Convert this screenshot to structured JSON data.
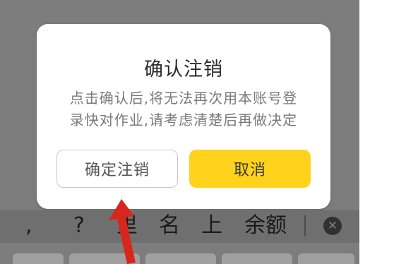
{
  "dialog": {
    "title": "确认注销",
    "message_line1": "点击确认后,将无法再次用本账号登",
    "message_line2": "录快对作业,请考虑清楚后再做决定",
    "confirm_label": "确定注销",
    "cancel_label": "取消",
    "cancel_color": "#ffd21c"
  },
  "keyboard": {
    "candidates": [
      ",",
      "?",
      "里",
      "名",
      "上",
      "余额"
    ],
    "delete_icon": "delete-icon"
  },
  "annotation": {
    "arrow_color": "#d9261c"
  }
}
